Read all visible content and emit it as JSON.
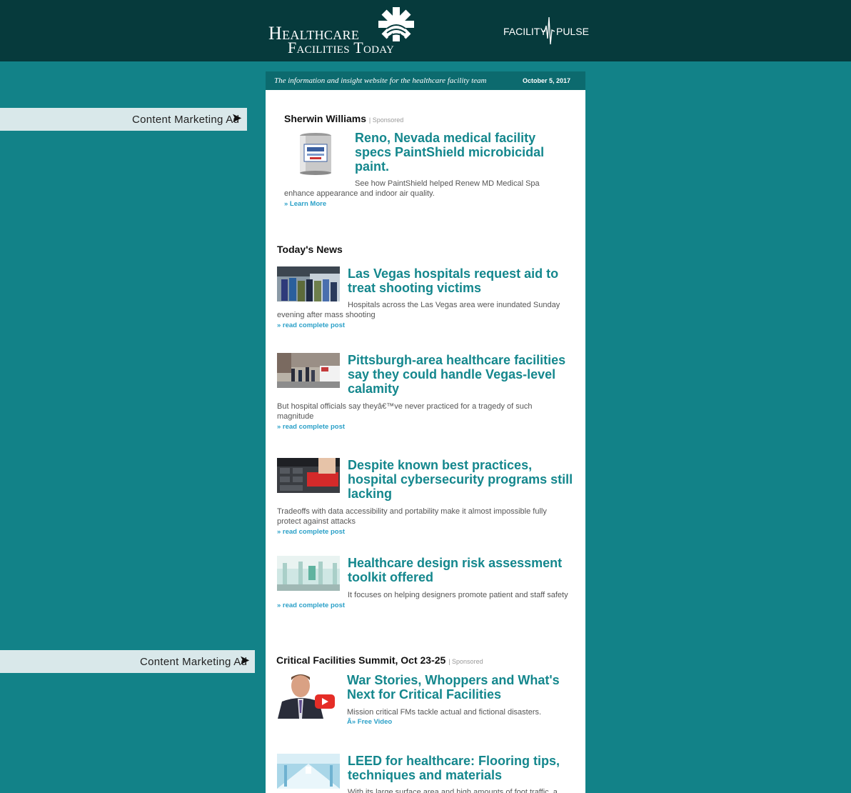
{
  "header": {
    "logo_line1": "Healthcare",
    "logo_line2": "Facilities Today",
    "pulse_left": "FACILITY",
    "pulse_right": "PULSE"
  },
  "side_ads": [
    {
      "label": "Content Marketing Ad",
      "arrow": "➤"
    },
    {
      "label": "Content Marketing Ad",
      "arrow": "➤"
    }
  ],
  "tagline": "The information and insight website for the healthcare facility team",
  "date": "October 5, 2017",
  "sponsored1": {
    "sponsor": "Sherwin Williams",
    "sponsored_label": "| Sponsored",
    "title": "Reno, Nevada medical facility specs PaintShield microbicidal paint.",
    "desc": "See how PaintShield helped Renew MD Medical Spa enhance appearance and indoor air quality.",
    "link": "» Learn More"
  },
  "news_heading": "Today's News",
  "news": [
    {
      "title": "Las Vegas hospitals request aid to treat shooting victims",
      "desc": "Hospitals across the Las Vegas area were inundated Sunday evening after mass shooting",
      "link": "» read complete post"
    },
    {
      "title": "Pittsburgh-area healthcare facilities say they could handle Vegas-level calamity",
      "desc": "But hospital officials say theyâ€™ve never practiced for a tragedy of such magnitude",
      "link": "» read complete post"
    },
    {
      "title": "Despite known best practices, hospital cybersecurity programs still lacking",
      "desc": "Tradeoffs with data accessibility and portability make it almost impossible fully protect against attacks",
      "link": "» read complete post"
    },
    {
      "title": "Healthcare design risk assessment toolkit offered",
      "desc": "It focuses on helping designers promote patient and staff safety",
      "link": "» read complete post"
    }
  ],
  "sponsored2": {
    "sponsor": "Critical Facilities Summit, Oct 23-25",
    "sponsored_label": "| Sponsored",
    "title": "War Stories, Whoppers and What's Next for Critical Facilities",
    "desc": "Mission critical FMs tackle actual and fictional disasters.",
    "link": "Â» Free Video"
  },
  "last_item": {
    "title": "LEED for healthcare: Flooring tips, techniques and materials",
    "desc": "With its large surface area and high amounts of foot traffic, a"
  },
  "colors": {
    "background": "#128288",
    "header": "#063a3c",
    "tagline_bar": "#0c6a6e",
    "title_teal": "#14878d",
    "link_blue": "#2aa0c8"
  }
}
